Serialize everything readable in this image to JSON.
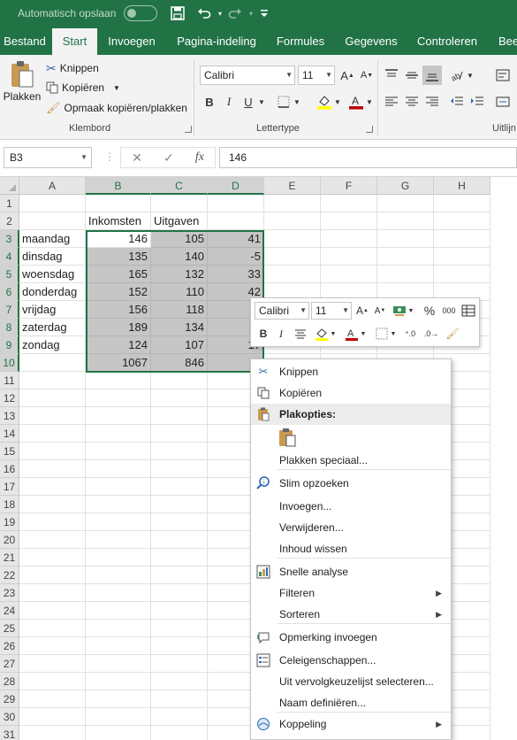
{
  "titlebar": {
    "autosave_label": "Automatisch opslaan",
    "qat": [
      "save-icon",
      "undo-icon",
      "redo-icon",
      "customize-icon"
    ]
  },
  "tabs": [
    "Bestand",
    "Start",
    "Invoegen",
    "Pagina-indeling",
    "Formules",
    "Gegevens",
    "Controleren",
    "Bee"
  ],
  "active_tab": "Start",
  "ribbon": {
    "clipboard": {
      "paste": "Plakken",
      "cut": "Knippen",
      "copy": "Kopiëren",
      "format_painter": "Opmaak kopiëren/plakken",
      "group_label": "Klembord"
    },
    "font": {
      "font_name": "Calibri",
      "font_size": "11",
      "bold": "B",
      "italic": "I",
      "underline": "U",
      "group_label": "Lettertype"
    },
    "alignment": {
      "group_label": "Uitlijn"
    }
  },
  "formula_bar": {
    "name_box": "B3",
    "fx": "fx",
    "value": "146"
  },
  "columns": [
    "A",
    "B",
    "C",
    "D",
    "E",
    "F",
    "G",
    "H"
  ],
  "rows": [
    "1",
    "2",
    "3",
    "4",
    "5",
    "6",
    "7",
    "8",
    "9",
    "10",
    "11",
    "12",
    "13",
    "14",
    "15",
    "16",
    "17",
    "18",
    "19",
    "20",
    "21",
    "22",
    "23",
    "24",
    "25",
    "26",
    "27",
    "28",
    "29",
    "30",
    "31"
  ],
  "sheet": {
    "headers": {
      "B": "Inkomsten",
      "C": "Uitgaven"
    },
    "data": [
      {
        "A": "maandag",
        "B": "146",
        "C": "105",
        "D": "41"
      },
      {
        "A": "dinsdag",
        "B": "135",
        "C": "140",
        "D": "-5"
      },
      {
        "A": "woensdag",
        "B": "165",
        "C": "132",
        "D": "33"
      },
      {
        "A": "donderdag",
        "B": "152",
        "C": "110",
        "D": "42"
      },
      {
        "A": "vrijdag",
        "B": "156",
        "C": "118",
        "D": ""
      },
      {
        "A": "zaterdag",
        "B": "189",
        "C": "134",
        "D": ""
      },
      {
        "A": "zondag",
        "B": "124",
        "C": "107",
        "D": "17"
      },
      {
        "A": "",
        "B": "1067",
        "C": "846",
        "D": ""
      }
    ]
  },
  "mini_toolbar": {
    "font_name": "Calibri",
    "font_size": "11",
    "percent": "%",
    "thousands": "000",
    "bold": "B",
    "italic": "I"
  },
  "context_menu": {
    "items": [
      {
        "label": "Knippen",
        "icon": "scissors-icon"
      },
      {
        "label": "Kopiëren",
        "icon": "copy-icon"
      },
      {
        "label": "Plakopties:",
        "icon": "paste-icon"
      },
      {
        "label": "Plakken speciaal...",
        "icon": ""
      },
      {
        "label": "Slim opzoeken",
        "icon": "smart-lookup-icon"
      },
      {
        "label": "Invoegen...",
        "icon": ""
      },
      {
        "label": "Verwijderen...",
        "icon": ""
      },
      {
        "label": "Inhoud wissen",
        "icon": ""
      },
      {
        "label": "Snelle analyse",
        "icon": "quick-analysis-icon"
      },
      {
        "label": "Filteren",
        "icon": ""
      },
      {
        "label": "Sorteren",
        "icon": ""
      },
      {
        "label": "Opmerking invoegen",
        "icon": "comment-icon"
      },
      {
        "label": "Celeigenschappen...",
        "icon": "format-cells-icon"
      },
      {
        "label": "Uit vervolgkeuzelijst selecteren...",
        "icon": ""
      },
      {
        "label": "Naam definiëren...",
        "icon": ""
      },
      {
        "label": "Koppeling",
        "icon": "link-icon"
      }
    ]
  }
}
